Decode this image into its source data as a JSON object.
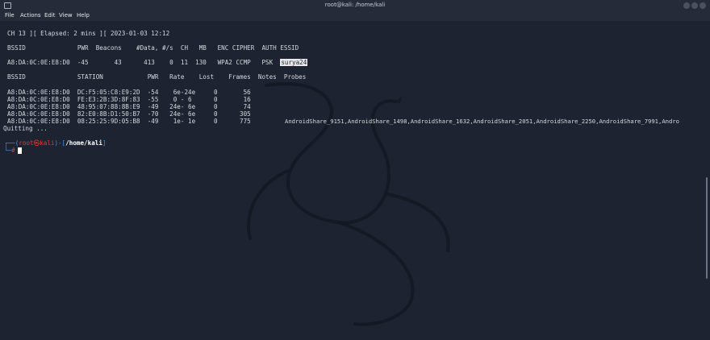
{
  "window": {
    "title": "root@kali: /home/kali"
  },
  "menu": [
    "File",
    "Actions",
    "Edit",
    "View",
    "Help"
  ],
  "status_line": "CH 13 ][ Elapsed: 2 mins ][ 2023-01-03 12:12",
  "ap_table": {
    "header": "BSSID              PWR  Beacons    #Data, #/s  CH   MB   ENC CIPHER  AUTH ESSID",
    "rows": [
      {
        "prefix": "A8:DA:0C:0E:E8:D0  -45       43      413    0  11  130   WPA2 CCMP   PSK  ",
        "essid": "surya24"
      }
    ]
  },
  "station_table": {
    "header": "BSSID              STATION            PWR   Rate    Lost    Frames  Notes  Probes",
    "rows": [
      "A8:DA:0C:0E:E8:D0  DC:F5:05:C8:E9:2D  -54    6e-24e     0       56",
      "A8:DA:0C:0E:E8:D0  FE:E3:2B:3D:8F:83  -55    0 - 6      0       16",
      "A8:DA:0C:0E:E8:D0  48:95:07:88:8B:E9  -49   24e- 6e     0       74",
      "A8:DA:0C:0E:E8:D0  82:E0:8B:D1:50:B7  -70   24e- 6e     0      305",
      "A8:DA:0C:0E:E8:D0  08:25:25:9D:05:B8  -49    1e- 1e     0      775"
    ],
    "probes": "AndroidShare_9151,AndroidShare_1498,AndroidShare_1632,AndroidShare_2051,AndroidShare_2250,AndroidShare_7991,Andro"
  },
  "quitting": "Quitting ...",
  "prompt": {
    "bracket_open": "┌──(",
    "user": "root",
    "at": "㉿",
    "host": "kali",
    "mid": ")-[",
    "path": "/home/kali",
    "close": "]",
    "second_prefix": "└─",
    "symbol": "#"
  },
  "colors": {
    "background": "#1d2330",
    "root_red": "#e53b3b",
    "prompt_blue": "#4c8fe0"
  }
}
